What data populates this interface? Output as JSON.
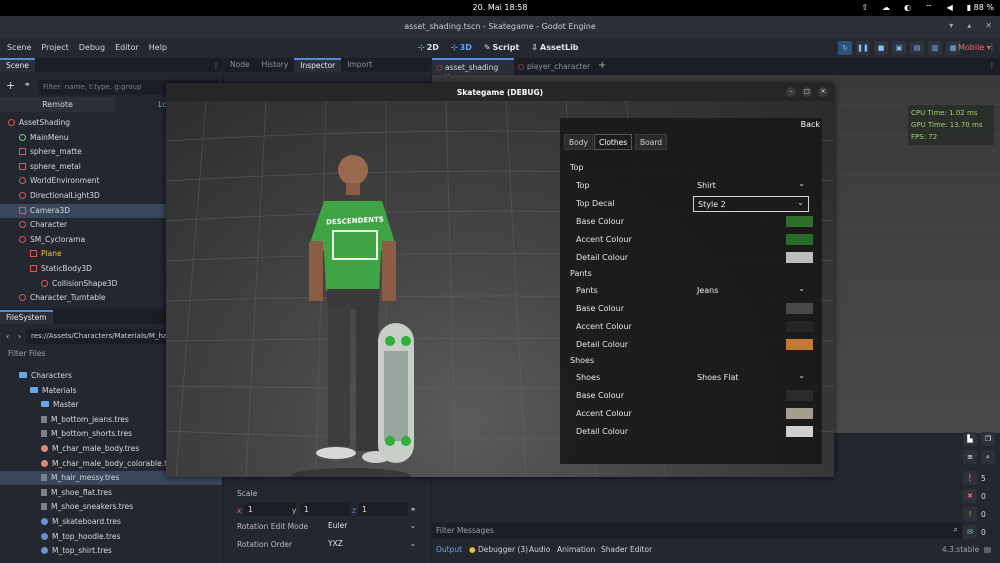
{
  "system": {
    "clock": "20. Mai  18:58",
    "battery": "88 %"
  },
  "window": {
    "title": "asset_shading.tscn - Skategame - Godot Engine"
  },
  "menu": [
    "Scene",
    "Project",
    "Debug",
    "Editor",
    "Help"
  ],
  "workspaces": [
    "2D",
    "3D",
    "Script",
    "AssetLib"
  ],
  "renderer": "Mobile",
  "scene_panel": {
    "tab": "Scene",
    "filter_placeholder": "Filter: name, t:type, g:group",
    "subtabs": [
      "Remote",
      "Local"
    ],
    "nodes": [
      {
        "label": "AssetShading",
        "icon": "node3d-icon",
        "indent": 0
      },
      {
        "label": "MainMenu",
        "icon": "control-icon",
        "indent": 1
      },
      {
        "label": "sphere_matte",
        "icon": "mesh-icon",
        "indent": 1
      },
      {
        "label": "sphere_metal",
        "icon": "mesh-icon",
        "indent": 1
      },
      {
        "label": "WorldEnvironment",
        "icon": "environment-icon",
        "indent": 1
      },
      {
        "label": "DirectionalLight3D",
        "icon": "light-icon",
        "indent": 1
      },
      {
        "label": "Camera3D",
        "icon": "camera-icon",
        "indent": 1
      },
      {
        "label": "Character",
        "icon": "node3d-icon",
        "indent": 1
      },
      {
        "label": "SM_Cyclorama",
        "icon": "node3d-icon",
        "indent": 1
      },
      {
        "label": "Plane",
        "icon": "mesh-icon",
        "indent": 2
      },
      {
        "label": "StaticBody3D",
        "icon": "staticbody-icon",
        "indent": 2
      },
      {
        "label": "CollisionShape3D",
        "icon": "collision-icon",
        "indent": 3
      },
      {
        "label": "Character_Turntable",
        "icon": "node3d-icon",
        "indent": 1
      }
    ]
  },
  "filesystem": {
    "tab": "FileSystem",
    "path": "res://Assets/Characters/Materials/M_ha",
    "filter_placeholder": "Filter Files",
    "items": [
      {
        "label": "Characters",
        "type": "folder",
        "indent": 1
      },
      {
        "label": "Materials",
        "type": "folder",
        "indent": 2
      },
      {
        "label": "Master",
        "type": "folder",
        "indent": 3
      },
      {
        "label": "M_bottom_jeans.tres",
        "type": "file",
        "indent": 3
      },
      {
        "label": "M_bottom_shorts.tres",
        "type": "file",
        "indent": 3
      },
      {
        "label": "M_char_male_body.tres",
        "type": "ball",
        "indent": 3
      },
      {
        "label": "M_char_male_body_colorable.tres",
        "type": "ball",
        "indent": 3
      },
      {
        "label": "M_hair_messy.tres",
        "type": "file",
        "indent": 3
      },
      {
        "label": "M_shoe_flat.tres",
        "type": "file",
        "indent": 3
      },
      {
        "label": "M_shoe_sneakers.tres",
        "type": "file",
        "indent": 3
      },
      {
        "label": "M_skateboard.tres",
        "type": "ball2",
        "indent": 3
      },
      {
        "label": "M_top_hoodie.tres",
        "type": "ball2",
        "indent": 3
      },
      {
        "label": "M_top_shirt.tres",
        "type": "ball2",
        "indent": 3
      }
    ]
  },
  "inspector": {
    "tabs": [
      "Node",
      "History",
      "Inspector",
      "Import"
    ],
    "scale_label": "Scale",
    "scale": {
      "x": "1",
      "y": "1",
      "z": "1"
    },
    "rotation_edit_mode_label": "Rotation Edit Mode",
    "rotation_edit_mode": "Euler",
    "rotation_order_label": "Rotation Order",
    "rotation_order": "YXZ"
  },
  "scene_tabs": [
    "asset_shading",
    "player_character"
  ],
  "perf": {
    "cpu": "CPU Time: 1.02 ms",
    "gpu": "GPU Time: 13.70 ms",
    "fps": "FPS: 72"
  },
  "game_window": {
    "title": "Skategame (DEBUG)",
    "shirt_print": "DESCENDENTS",
    "back": "Back",
    "tabs": [
      "Body",
      "Clothes",
      "Board"
    ],
    "sections": {
      "top": "Top",
      "pants": "Pants",
      "shoes": "Shoes"
    },
    "rows": {
      "top": "Top",
      "top_value": "Shirt",
      "top_decal": "Top Decal",
      "top_decal_value": "Style 2",
      "base_colour": "Base Colour",
      "accent_colour": "Accent Colour",
      "detail_colour": "Detail Colour",
      "pants": "Pants",
      "pants_value": "Jeans",
      "shoes": "Shoes",
      "shoes_value": "Shoes Flat"
    },
    "colors": {
      "top_base": "#2f6e2b",
      "top_accent": "#2c6a28",
      "top_detail": "#bdbdbd",
      "pants_base": "#4a4a4a",
      "pants_accent": "#262626",
      "pants_detail": "#c07a36",
      "shoes_base": "#2a2a2a",
      "shoes_accent": "#a59c90",
      "shoes_detail": "#d0d0d0"
    }
  },
  "bottom_panel": {
    "filter_placeholder": "Filter Messages",
    "tabs": [
      "Output",
      "Debugger (3)",
      "Audio",
      "Animation",
      "Shader Editor"
    ],
    "version": "4.3.stable",
    "counts": [
      "5",
      "0",
      "0",
      "0"
    ]
  }
}
